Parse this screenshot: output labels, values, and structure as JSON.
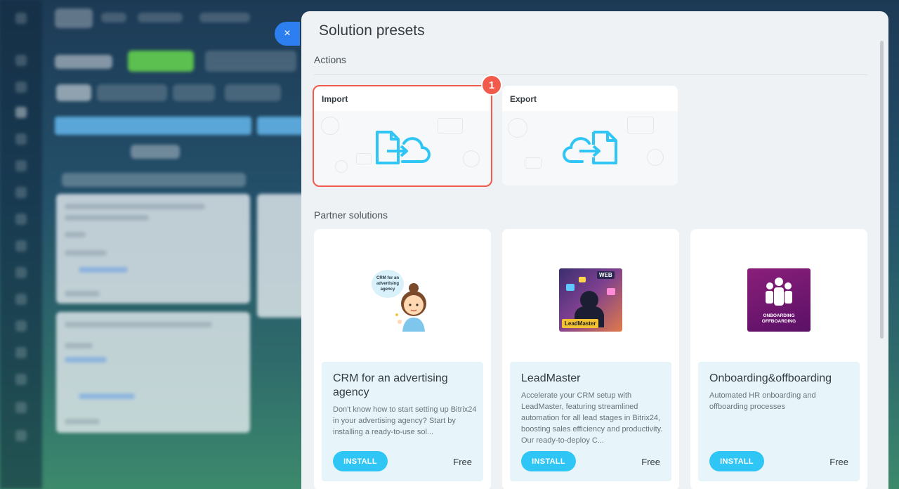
{
  "background": {
    "close_glyph": "×"
  },
  "panel": {
    "title": "Solution presets",
    "actions_title": "Actions",
    "partner_title": "Partner solutions"
  },
  "actions": [
    {
      "label": "Import",
      "icon": "import-cloud-icon"
    },
    {
      "label": "Export",
      "icon": "export-cloud-icon"
    }
  ],
  "highlight": {
    "number": "1",
    "color": "#f25a4b"
  },
  "partners": [
    {
      "title": "CRM for an advertising agency",
      "description": "Don't know how to start setting up Bitrix24 in your advertising agency? Start by installing a ready-to-use sol...",
      "button": "INSTALL",
      "price": "Free",
      "logo_text": "CRM for an advertising agency"
    },
    {
      "title": "LeadMaster",
      "description": "Accelerate your CRM setup with LeadMaster, featuring streamlined automation for all lead stages in Bitrix24, boosting sales efficiency and productivity. Our ready-to-deploy C...",
      "button": "INSTALL",
      "price": "Free",
      "logo_text": "LeadMaster",
      "logo_sign": "WEB"
    },
    {
      "title": "Onboarding&offboarding",
      "description": "Automated HR onboarding and offboarding processes",
      "button": "INSTALL",
      "price": "Free",
      "logo_text_1": "ONBOARDING",
      "logo_text_2": "OFFBOARDING"
    }
  ],
  "colors": {
    "accent": "#2fc6f6",
    "icon": "#2fc6f6",
    "close": "#2d7ff0"
  }
}
